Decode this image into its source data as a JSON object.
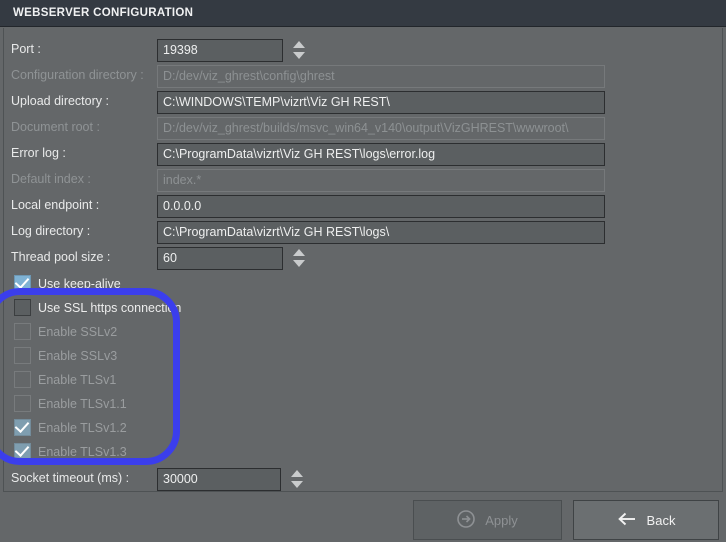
{
  "window": {
    "title": "WEBSERVER CONFIGURATION"
  },
  "form": {
    "rows": [
      {
        "label": "Port :",
        "value": "19398",
        "disabled": false,
        "size": "small",
        "spinner": true
      },
      {
        "label": "Configuration directory :",
        "value": "D:/dev/viz_ghrest\\config\\ghrest",
        "disabled": true,
        "size": "wide",
        "spinner": false
      },
      {
        "label": "Upload directory :",
        "value": "C:\\WINDOWS\\TEMP\\vizrt\\Viz GH REST\\",
        "disabled": false,
        "size": "wide",
        "spinner": false
      },
      {
        "label": "Document root :",
        "value": "D:/dev/viz_ghrest/builds/msvc_win64_v140\\output\\VizGHREST\\wwwroot\\",
        "disabled": true,
        "size": "wide",
        "spinner": false
      },
      {
        "label": "Error log :",
        "value": "C:\\ProgramData\\vizrt\\Viz GH REST\\logs\\error.log",
        "disabled": false,
        "size": "wide",
        "spinner": false
      },
      {
        "label": "Default index :",
        "value": "index.*",
        "disabled": true,
        "size": "wide",
        "spinner": false
      },
      {
        "label": "Local endpoint :",
        "value": "0.0.0.0",
        "disabled": false,
        "size": "wide",
        "spinner": false
      },
      {
        "label": "Log directory :",
        "value": "C:\\ProgramData\\vizrt\\Viz GH REST\\logs\\",
        "disabled": false,
        "size": "wide",
        "spinner": false
      },
      {
        "label": "Thread pool size :",
        "value": "60",
        "disabled": false,
        "size": "small",
        "spinner": true
      }
    ],
    "socket_timeout": {
      "label": "Socket timeout (ms) :",
      "value": "30000",
      "disabled": false,
      "size": "medium",
      "spinner": true
    }
  },
  "checkboxes": [
    {
      "label": "Use keep-alive",
      "checked": true,
      "disabled": false
    },
    {
      "label": "Use SSL https connection",
      "checked": false,
      "disabled": false
    },
    {
      "label": "Enable SSLv2",
      "checked": false,
      "disabled": true
    },
    {
      "label": "Enable SSLv3",
      "checked": false,
      "disabled": true
    },
    {
      "label": "Enable TLSv1",
      "checked": false,
      "disabled": true
    },
    {
      "label": "Enable TLSv1.1",
      "checked": false,
      "disabled": true
    },
    {
      "label": "Enable TLSv1.2",
      "checked": true,
      "disabled": true
    },
    {
      "label": "Enable TLSv1.3",
      "checked": true,
      "disabled": true
    }
  ],
  "footer": {
    "apply_label": "Apply",
    "apply_icon": "arrow-right-circle-icon",
    "apply_disabled": true,
    "back_label": "Back",
    "back_icon": "arrow-left-icon"
  },
  "annotation": {
    "shape": "rounded-rectangle",
    "color": "#3b3eec",
    "highlights": "ssl-checkbox-group"
  },
  "colors": {
    "window_background": "#646769",
    "title_bar": "#343a42",
    "field_background": "#5b5f61",
    "field_border": "#2c2e30",
    "disabled_text": "#8d9193",
    "checkbox_checked": "#7fb2d4",
    "checkbox_checked_disabled": "#7f9eb0",
    "annotation_blue": "#3b3eec"
  }
}
